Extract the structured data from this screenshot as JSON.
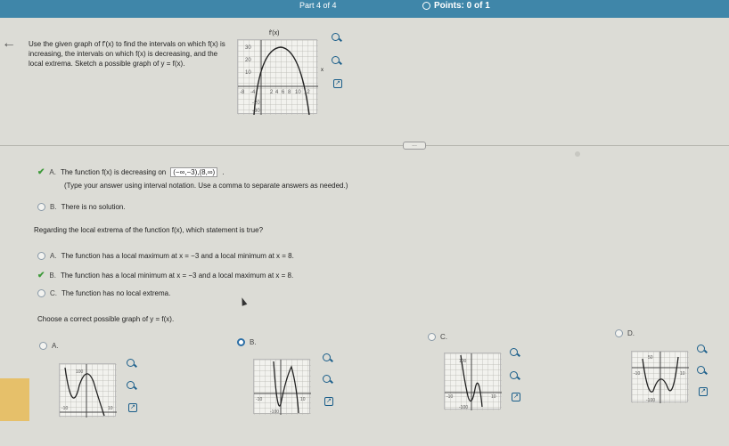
{
  "header": {
    "part": "Part 4 of 4",
    "points": "Points: 0 of 1"
  },
  "question": {
    "text": "Use the given graph of f'(x) to find the intervals on which f(x) is increasing, the intervals on which f(x) is decreasing, and the local extrema. Sketch a possible graph of y = f(x).",
    "graph_label": "f'(x)",
    "tick_labels": [
      "30",
      "20",
      "10",
      "-8",
      "-4",
      "2",
      "4",
      "6",
      "8",
      "10",
      "12",
      "-20",
      "-30"
    ],
    "x_label": "x"
  },
  "part_a": {
    "option_a_prefix": "A.",
    "option_a_text": "The function f(x) is decreasing on",
    "option_a_value": "(−∞,−3),(8,∞)",
    "option_a_hint": "(Type your answer using interval notation. Use a comma to separate answers as needed.)",
    "option_b_prefix": "B.",
    "option_b_text": "There is no solution."
  },
  "extrema": {
    "prompt": "Regarding the local extrema of the function f(x), which statement is true?",
    "options": [
      {
        "letter": "A.",
        "text": "The function has a local maximum at x = −3 and a local minimum at x = 8."
      },
      {
        "letter": "B.",
        "text": "The function has a local minimum at x = −3 and a local maximum at x = 8."
      },
      {
        "letter": "C.",
        "text": "The function has no local extrema."
      }
    ]
  },
  "graph_choice": {
    "prompt": "Choose a correct possible graph of y = f(x).",
    "options": [
      {
        "letter": "A.",
        "ticks": [
          "100",
          "-10",
          "10"
        ]
      },
      {
        "letter": "B.",
        "ticks": [
          "-10",
          "10",
          "-100"
        ]
      },
      {
        "letter": "C.",
        "ticks": [
          "100",
          "-10",
          "10",
          "-100"
        ]
      },
      {
        "letter": "D.",
        "ticks": [
          "50",
          "-10",
          "10",
          "-100"
        ]
      }
    ],
    "axis_y": "y",
    "axis_x": "x"
  },
  "colors": {
    "header": "#3f86a9",
    "accent": "#2c6fa6",
    "check": "#3e9a3a",
    "sidebar_tab": "#e6c06a"
  },
  "icons": [
    "back-arrow-icon",
    "magnify-plus-icon",
    "magnify-minus-icon",
    "external-link-icon",
    "more-dots-icon",
    "check-icon"
  ]
}
